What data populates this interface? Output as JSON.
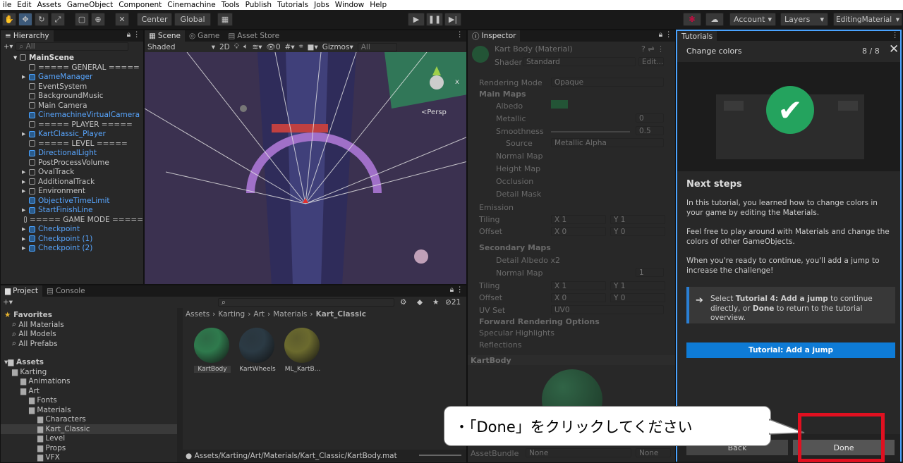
{
  "menu": [
    "ile",
    "Edit",
    "Assets",
    "GameObject",
    "Component",
    "Cinemachine",
    "Tools",
    "Publish",
    "Tutorials",
    "Jobs",
    "Window",
    "Help"
  ],
  "toolbar": {
    "center": "Center",
    "global": "Global",
    "account": "Account",
    "layers": "Layers",
    "layout": "EditingMaterial"
  },
  "hierarchy": {
    "tab": "Hierarchy",
    "search": "All",
    "scene": "MainScene",
    "items": [
      {
        "label": "===== GENERAL =====",
        "blue": false,
        "arrow": false
      },
      {
        "label": "GameManager",
        "blue": true,
        "arrow": true
      },
      {
        "label": "EventSystem",
        "blue": false,
        "arrow": false
      },
      {
        "label": "BackgroundMusic",
        "blue": false,
        "arrow": false
      },
      {
        "label": "Main Camera",
        "blue": false,
        "arrow": false
      },
      {
        "label": "CinemachineVirtualCamera",
        "blue": true,
        "arrow": false
      },
      {
        "label": "===== PLAYER =====",
        "blue": false,
        "arrow": false
      },
      {
        "label": "KartClassic_Player",
        "blue": true,
        "arrow": true
      },
      {
        "label": "===== LEVEL =====",
        "blue": false,
        "arrow": false
      },
      {
        "label": "DirectionalLight",
        "blue": true,
        "arrow": false
      },
      {
        "label": "PostProcessVolume",
        "blue": false,
        "arrow": false
      },
      {
        "label": "OvalTrack",
        "blue": false,
        "arrow": true
      },
      {
        "label": "AdditionalTrack",
        "blue": false,
        "arrow": true
      },
      {
        "label": "Environment",
        "blue": false,
        "arrow": true
      },
      {
        "label": "ObjectiveTimeLimit",
        "blue": true,
        "arrow": false
      },
      {
        "label": "StartFinishLine",
        "blue": true,
        "arrow": true
      },
      {
        "label": "===== GAME MODE =====",
        "blue": false,
        "arrow": false
      },
      {
        "label": "Checkpoint",
        "blue": true,
        "arrow": true
      },
      {
        "label": "Checkpoint (1)",
        "blue": true,
        "arrow": true
      },
      {
        "label": "Checkpoint (2)",
        "blue": true,
        "arrow": true
      }
    ]
  },
  "scene": {
    "tabs": [
      "Scene",
      "Game",
      "Asset Store"
    ],
    "shaded": "Shaded",
    "mode2d": "2D",
    "hidden": "0",
    "gizmos": "Gizmos",
    "search": "All",
    "persp": "<Persp",
    "axis_x": "x"
  },
  "project": {
    "tabs": [
      "Project",
      "Console"
    ],
    "count": "21",
    "favorites": {
      "title": "Favorites",
      "items": [
        "All Materials",
        "All Models",
        "All Prefabs"
      ]
    },
    "assets_title": "Assets",
    "tree": [
      {
        "label": "Karting",
        "indent": 1
      },
      {
        "label": "Animations",
        "indent": 2
      },
      {
        "label": "Art",
        "indent": 2
      },
      {
        "label": "Fonts",
        "indent": 3
      },
      {
        "label": "Materials",
        "indent": 3
      },
      {
        "label": "Characters",
        "indent": 4
      },
      {
        "label": "Kart_Classic",
        "indent": 4
      },
      {
        "label": "Level",
        "indent": 4
      },
      {
        "label": "Props",
        "indent": 4
      },
      {
        "label": "VFX",
        "indent": 4
      }
    ],
    "breadcrumb": [
      "Assets",
      "Karting",
      "Art",
      "Materials",
      "Kart_Classic"
    ],
    "materials": [
      {
        "label": "KartBody",
        "color": "#2f7a4d"
      },
      {
        "label": "KartWheels",
        "color": "#2b3a44"
      },
      {
        "label": "ML_KartB...",
        "color": "#6b6a2e"
      }
    ],
    "path": "Assets/Karting/Art/Materials/Kart_Classic/KartBody.mat"
  },
  "inspector": {
    "tab": "Inspector",
    "title": "Kart Body (Material)",
    "shader_label": "Shader",
    "shader": "Standard",
    "edit": "Edit...",
    "rendering_mode_label": "Rendering Mode",
    "rendering_mode": "Opaque",
    "main_maps": "Main Maps",
    "albedo": "Albedo",
    "albedo_color": "#1f8a49",
    "metallic": "Metallic",
    "metallic_value": "0",
    "smoothness": "Smoothness",
    "smoothness_value": "0.5",
    "source": "Source",
    "source_value": "Metallic Alpha",
    "normal_map": "Normal Map",
    "height_map": "Height Map",
    "occlusion": "Occlusion",
    "detail_mask": "Detail Mask",
    "emission": "Emission",
    "tiling": "Tiling",
    "offset": "Offset",
    "x": "X",
    "y": "Y",
    "one": "1",
    "zero": "0",
    "secondary_maps": "Secondary Maps",
    "detail_albedo": "Detail Albedo x2",
    "normal_map2": "Normal Map",
    "normal_value": "1",
    "uv_set": "UV Set",
    "uv_value": "UV0",
    "forward": "Forward Rendering Options",
    "specular": "Specular Highlights",
    "reflections": "Reflections",
    "preview_title": "KartBody",
    "assetbundle": "AssetBundle",
    "none": "None"
  },
  "tutorial": {
    "tab": "Tutorials",
    "header": "Change colors",
    "progress": "8 / 8",
    "heading": "Next steps",
    "p1": "In this tutorial, you learned how to change colors in your game by editing the Materials.",
    "p2": "Feel free to play around with Materials and change the colors of other GameObjects.",
    "p3": "When you're ready to continue, you'll add a jump to increase the challenge!",
    "info_pre": "Select ",
    "info_b1": "Tutorial 4: Add a jump",
    "info_mid": " to continue directly, or ",
    "info_b2": "Done",
    "info_post": " to return to the tutorial overview.",
    "link_button": "Tutorial: Add a jump",
    "back": "Back",
    "done": "Done",
    "accent": "#0e7bd6"
  },
  "callout": {
    "text": "・「Done」をクリックしてください",
    "highlight": "#e01020"
  }
}
